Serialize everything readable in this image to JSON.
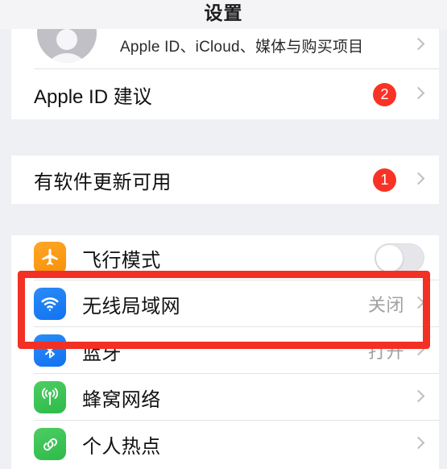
{
  "navbar": {
    "title": "设置"
  },
  "groups": [
    {
      "id": "apple-id-group",
      "rows": [
        {
          "key": "apple-id",
          "icon": "avatar",
          "label": "",
          "subtitle": "Apple ID、iCloud、媒体与购买项目",
          "accessory": "chevron"
        },
        {
          "key": "apple-id-suggestion",
          "label": "Apple ID 建议",
          "badge": "2",
          "accessory": "chevron"
        }
      ]
    },
    {
      "id": "software-update-group",
      "rows": [
        {
          "key": "software-update",
          "label": "有软件更新可用",
          "badge": "1",
          "accessory": "chevron"
        }
      ]
    },
    {
      "id": "connectivity-group",
      "rows": [
        {
          "key": "airplane-mode",
          "icon": "airplane-icon",
          "label": "飞行模式",
          "accessory": "toggle",
          "toggle_on": false
        },
        {
          "key": "wifi",
          "icon": "wifi-icon",
          "label": "无线局域网",
          "value": "关闭",
          "accessory": "chevron"
        },
        {
          "key": "bluetooth",
          "icon": "bluetooth-icon",
          "label": "蓝牙",
          "value": "打开",
          "accessory": "chevron"
        },
        {
          "key": "cellular",
          "icon": "cellular-icon",
          "label": "蜂窝网络",
          "value": "",
          "accessory": "chevron"
        },
        {
          "key": "personal-hotspot",
          "icon": "hotspot-icon",
          "label": "个人热点",
          "value": "",
          "accessory": "chevron"
        }
      ]
    }
  ],
  "annotation": {
    "type": "rectangle-highlight",
    "color": "#ef3124",
    "target": "无线局域网"
  },
  "colors": {
    "badge_red": "#f53427",
    "annotation_red": "#ef3124",
    "icon_orange": "#f79009",
    "icon_blue": "#1372ef",
    "icon_green": "#2fb94a",
    "page_background": "#eff0f4",
    "panel_background": "#ffffff",
    "value_text": "#a0a0a5"
  }
}
